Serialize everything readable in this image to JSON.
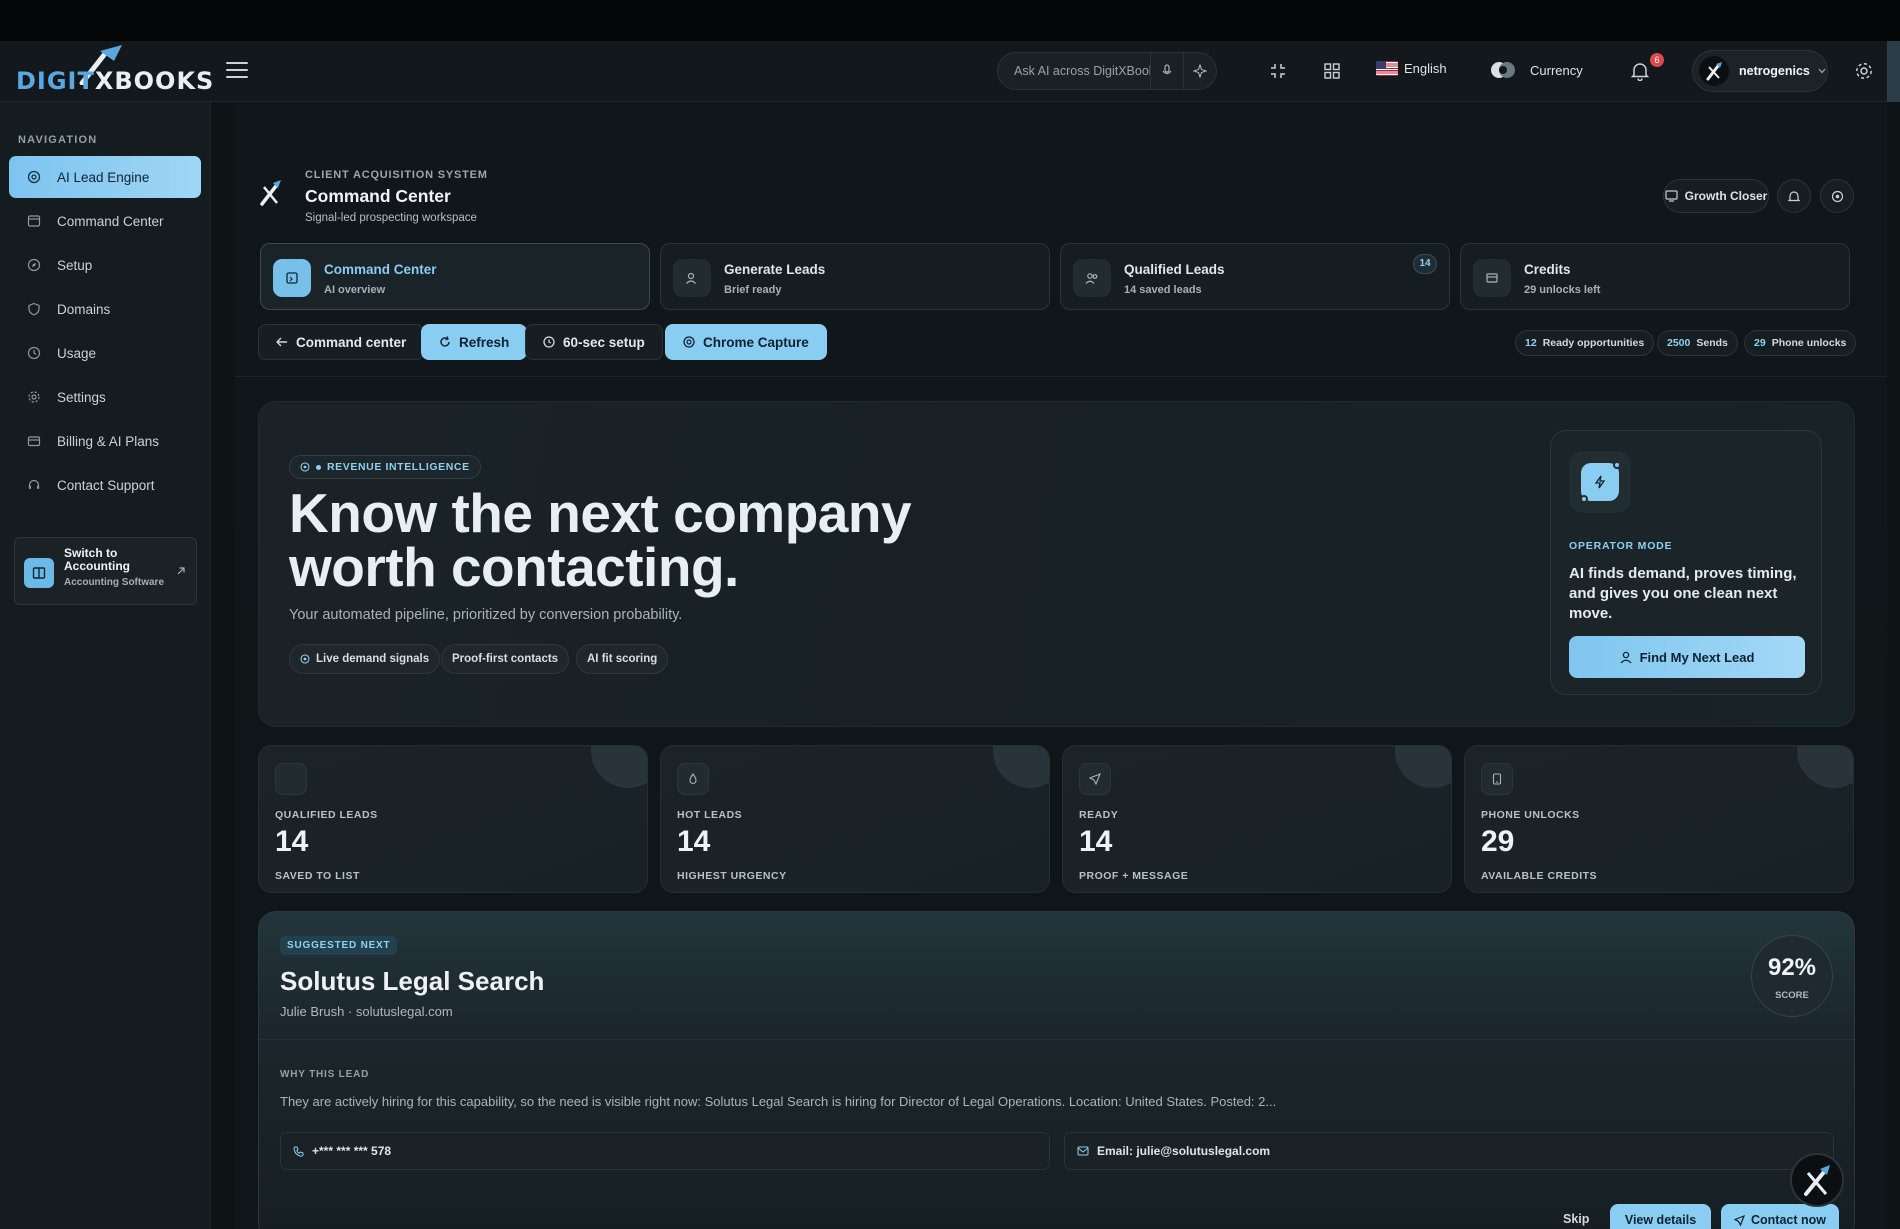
{
  "header": {
    "logo_prefix": "DIGIT",
    "logo_suffix": "XBOOKS",
    "search_placeholder": "Ask AI across DigitXBooks",
    "language": "English",
    "currency_label": "Currency",
    "notifications_count": "6",
    "username": "netrogenics"
  },
  "sidebar": {
    "section_label": "NAVIGATION",
    "items": [
      {
        "label": "AI Lead Engine",
        "icon": "target-icon",
        "active": true
      },
      {
        "label": "Command Center",
        "icon": "window-icon"
      },
      {
        "label": "Setup",
        "icon": "compass-icon"
      },
      {
        "label": "Domains",
        "icon": "shield-icon"
      },
      {
        "label": "Usage",
        "icon": "clock-icon"
      },
      {
        "label": "Settings",
        "icon": "gear-icon"
      },
      {
        "label": "Billing & AI Plans",
        "icon": "card-icon"
      },
      {
        "label": "Contact Support",
        "icon": "headset-icon"
      }
    ],
    "switch_card": {
      "title": "Switch to Accounting",
      "subtitle": "Accounting Software"
    }
  },
  "page": {
    "eyebrow": "CLIENT ACQUISITION SYSTEM",
    "title": "Command Center",
    "subtitle": "Signal-led prospecting workspace",
    "growth_button": "Growth Closer"
  },
  "steps": [
    {
      "title": "Command Center",
      "sub": "AI overview",
      "active": true
    },
    {
      "title": "Generate Leads",
      "sub": "Brief ready"
    },
    {
      "title": "Qualified Leads",
      "sub": "14 saved leads",
      "badge": "14"
    },
    {
      "title": "Credits",
      "sub": "29 unlocks left"
    }
  ],
  "actions": {
    "back": "Command center",
    "refresh": "Refresh",
    "setup": "60-sec setup",
    "capture": "Chrome Capture"
  },
  "chips": [
    {
      "value": "12",
      "label": "Ready opportunities"
    },
    {
      "value": "2500",
      "label": "Sends"
    },
    {
      "value": "29",
      "label": "Phone unlocks"
    }
  ],
  "hero": {
    "pill": "REVENUE INTELLIGENCE",
    "title": "Know the next company worth contacting.",
    "subtitle": "Your automated pipeline, prioritized by conversion probability.",
    "tags": [
      "Live demand signals",
      "Proof-first contacts",
      "AI fit scoring"
    ],
    "operator": {
      "label": "OPERATOR MODE",
      "text": "AI finds demand, proves timing, and gives you one clean next move.",
      "button": "Find My Next Lead"
    }
  },
  "metrics": [
    {
      "label": "QUALIFIED LEADS",
      "value": "14",
      "sub": "SAVED TO LIST"
    },
    {
      "label": "HOT LEADS",
      "value": "14",
      "sub": "HIGHEST URGENCY"
    },
    {
      "label": "READY",
      "value": "14",
      "sub": "PROOF + MESSAGE"
    },
    {
      "label": "PHONE UNLOCKS",
      "value": "29",
      "sub": "AVAILABLE CREDITS"
    }
  ],
  "suggested": {
    "pill": "SUGGESTED NEXT",
    "company": "Solutus Legal Search",
    "contact_line": "Julie Brush · solutuslegal.com",
    "score": "92%",
    "score_label": "SCORE",
    "why_label": "WHY THIS LEAD",
    "why_text": "They are actively hiring for this capability, so the need is visible right now: Solutus Legal Search is hiring for Director of Legal Operations. Location: United States. Posted: 2...",
    "phone": "+*** *** *** 578",
    "email": "Email: julie@solutuslegal.com",
    "skip": "Skip",
    "view": "View details",
    "contact": "Contact now"
  }
}
